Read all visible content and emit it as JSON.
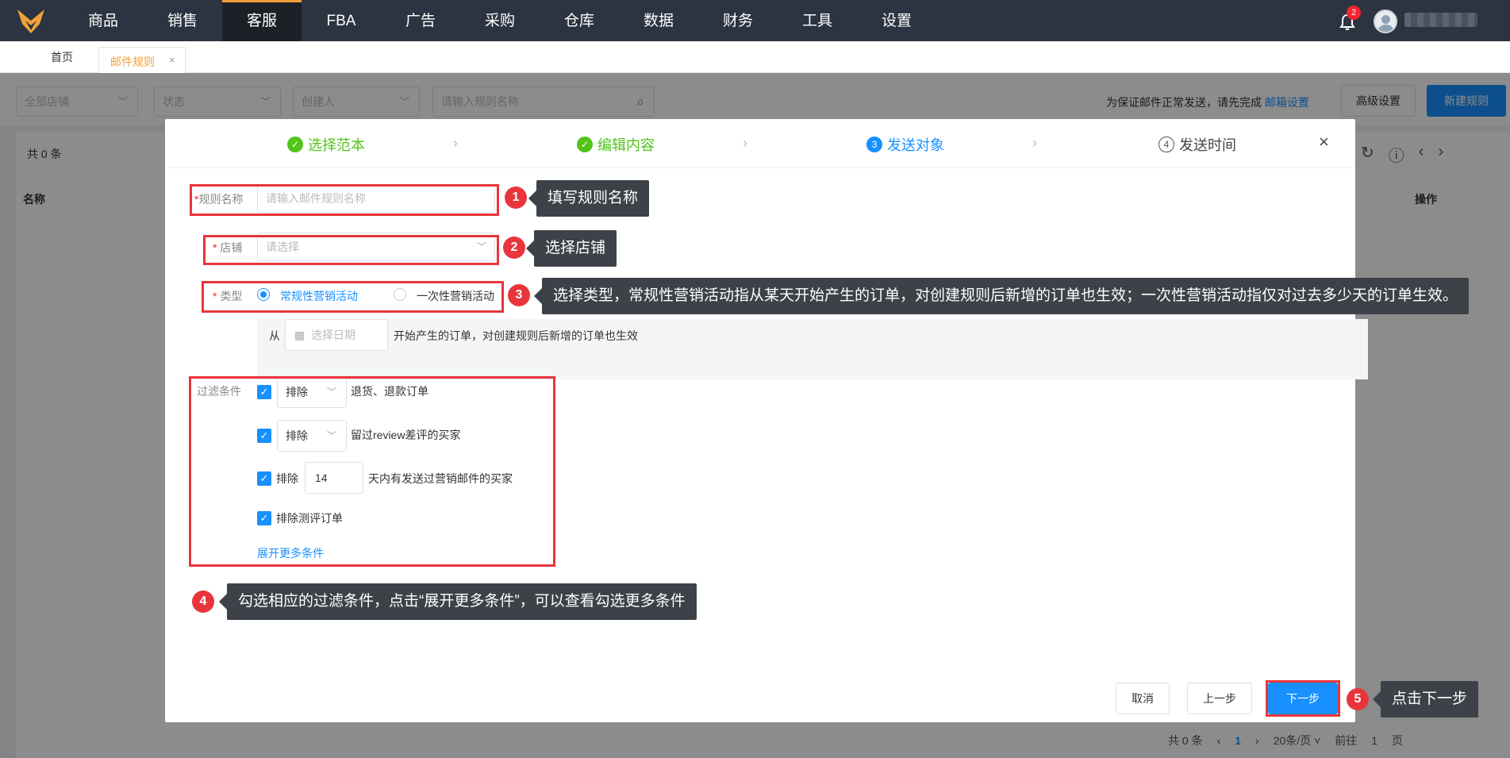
{
  "nav": {
    "items": [
      "商品",
      "销售",
      "客服",
      "FBA",
      "广告",
      "采购",
      "仓库",
      "数据",
      "财务",
      "工具",
      "设置"
    ],
    "active_index": 2,
    "notification_count": "2"
  },
  "tabs": {
    "home": "首页",
    "active": "邮件规则",
    "close": "×"
  },
  "filters": {
    "store": "全部店铺",
    "status": "状态",
    "creator": "创建人",
    "search_placeholder": "请输入规则名称",
    "notice": "为保证邮件正常发送，请先完成",
    "notice_link": "邮箱设置",
    "advanced": "高级设置",
    "new_rule": "新建规则"
  },
  "list": {
    "count": "共 0 条",
    "col_name": "名称",
    "col_op": "操作"
  },
  "pager": {
    "total": "共 0 条",
    "prev": "‹",
    "page": "1",
    "next": "›",
    "size": "20条/页 ˅",
    "goto": "前往",
    "goto_page": "1",
    "page_unit": "页"
  },
  "modal": {
    "steps": [
      {
        "icon": "✓",
        "label": "选择范本",
        "state": "done"
      },
      {
        "icon": "✓",
        "label": "编辑内容",
        "state": "done"
      },
      {
        "icon": "3",
        "label": "发送对象",
        "state": "current"
      },
      {
        "icon": "4",
        "label": "发送时间",
        "state": "todo"
      }
    ],
    "close": "×",
    "rule_name_label": "规则名称",
    "rule_name_placeholder": "请输入邮件规则名称",
    "store_label": "店铺",
    "store_placeholder": "请选择",
    "type_label": "类型",
    "type_option_1": "常规性营销活动",
    "type_option_2": "一次性营销活动",
    "date_prefix": "从",
    "date_placeholder": "选择日期",
    "date_suffix": "开始产生的订单，对创建规则后新增的订单也生效",
    "filter_label": "过滤条件",
    "filters": [
      {
        "select": "排除",
        "text": "退货、退款订单"
      },
      {
        "select": "排除",
        "text": "留过review差评的买家"
      }
    ],
    "filter_days_prefix": "排除",
    "filter_days_value": "14",
    "filter_days_suffix": "天内有发送过营销邮件的买家",
    "filter_review": "排除测评订单",
    "expand_more": "展开更多条件",
    "cancel": "取消",
    "prev": "上一步",
    "next": "下一步"
  },
  "annotations": [
    {
      "num": "1",
      "text": "填写规则名称"
    },
    {
      "num": "2",
      "text": "选择店铺"
    },
    {
      "num": "3",
      "text": "选择类型，常规性营销活动指从某天开始产生的订单，对创建规则后新增的订单也生效；一次性营销活动指仅对过去多少天的订单生效。"
    },
    {
      "num": "4",
      "text": "勾选相应的过滤条件，点击“展开更多条件”，可以查看勾选更多条件"
    },
    {
      "num": "5",
      "text": "点击下一步"
    }
  ],
  "colors": {
    "topnav": "#2b3440",
    "accent": "#1890ff",
    "orange": "#f0a23a",
    "success": "#52c41a",
    "annotation_red": "#e8353b"
  }
}
